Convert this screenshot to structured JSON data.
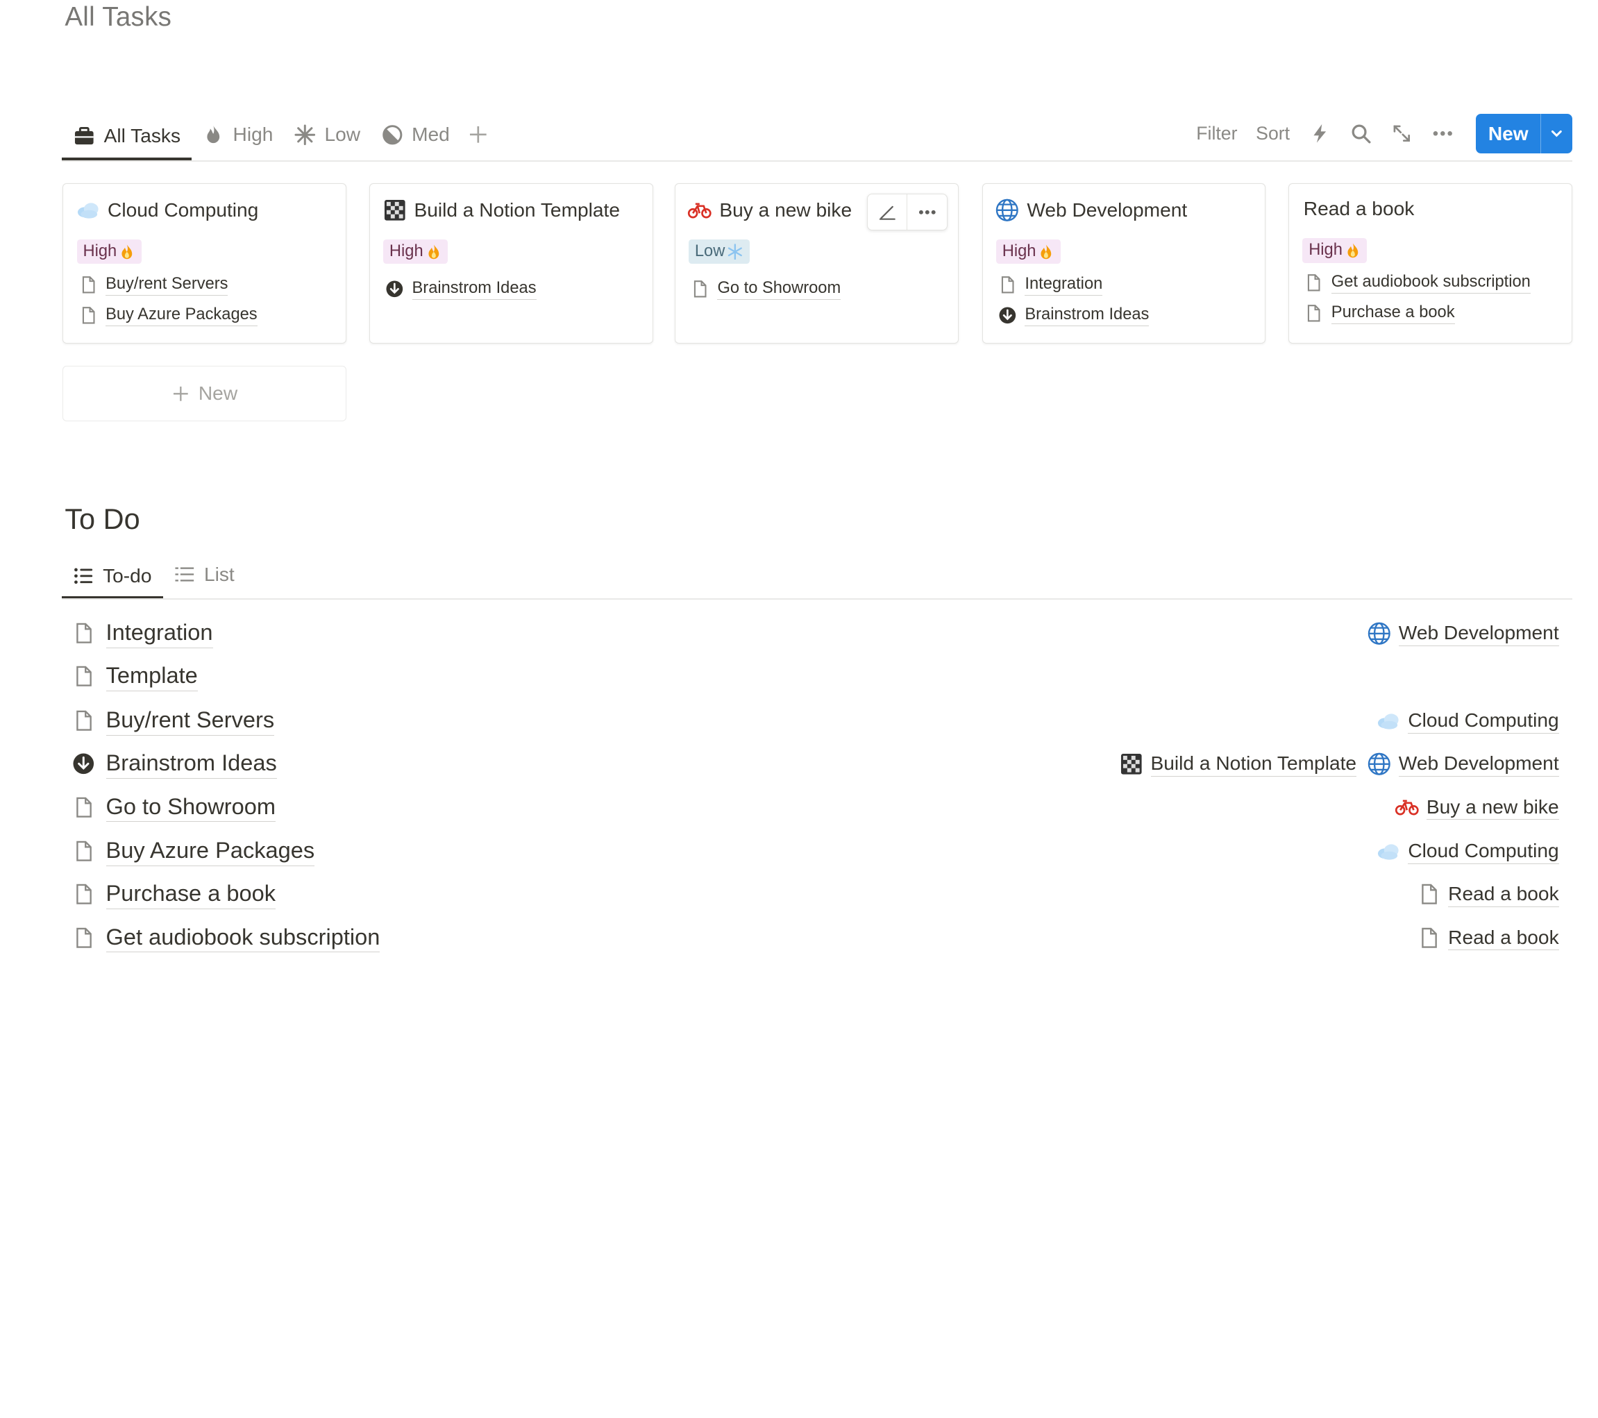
{
  "page": {
    "title": "All Tasks"
  },
  "tabs": [
    {
      "label": "All Tasks",
      "icon": "briefcase-icon",
      "active": true
    },
    {
      "label": "High",
      "icon": "flame-icon"
    },
    {
      "label": "Low",
      "icon": "snowflake-icon"
    },
    {
      "label": "Med",
      "icon": "half-circle-icon"
    }
  ],
  "toolbar": {
    "filter": "Filter",
    "sort": "Sort",
    "new_label": "New"
  },
  "colors": {
    "accent": "#2383e2",
    "high_tag_bg": "#f6e7f6",
    "low_tag_bg": "#ddebf1"
  },
  "cards": [
    {
      "title": "Cloud Computing",
      "icon": "cloud-icon",
      "priority": "High",
      "items": [
        {
          "label": "Buy/rent Servers",
          "icon": "page-icon"
        },
        {
          "label": "Buy Azure Packages",
          "icon": "page-icon"
        }
      ]
    },
    {
      "title": "Build a Notion Template",
      "icon": "checkerboard-icon",
      "priority": "High",
      "items": [
        {
          "label": "Brainstrom Ideas",
          "icon": "arrow-down-circle-icon"
        }
      ]
    },
    {
      "title": "Buy a new bike",
      "icon": "bicycle-icon",
      "priority": "Low",
      "items": [
        {
          "label": "Go to Showroom",
          "icon": "page-icon"
        }
      ]
    },
    {
      "title": "Web Development",
      "icon": "globe-icon",
      "priority": "High",
      "items": [
        {
          "label": "Integration",
          "icon": "page-icon"
        },
        {
          "label": "Brainstrom Ideas",
          "icon": "arrow-down-circle-icon"
        }
      ]
    },
    {
      "title": "Read a book",
      "icon": "",
      "priority": "High",
      "items": [
        {
          "label": "Get audiobook subscription",
          "icon": "page-icon"
        },
        {
          "label": "Purchase a book",
          "icon": "page-icon"
        }
      ]
    }
  ],
  "new_card_label": "New",
  "todo": {
    "heading": "To Do",
    "tabs": [
      {
        "label": "To-do",
        "active": true
      },
      {
        "label": "List"
      }
    ],
    "rows": [
      {
        "label": "Integration",
        "icon": "page-icon",
        "relations": [
          {
            "label": "Web Development",
            "icon": "globe-icon"
          }
        ]
      },
      {
        "label": "Template",
        "icon": "page-icon",
        "relations": []
      },
      {
        "label": "Buy/rent Servers",
        "icon": "page-icon",
        "relations": [
          {
            "label": "Cloud Computing",
            "icon": "cloud-icon"
          }
        ]
      },
      {
        "label": "Brainstrom Ideas",
        "icon": "arrow-down-circle-icon",
        "relations": [
          {
            "label": "Build a Notion Template",
            "icon": "checkerboard-icon"
          },
          {
            "label": "Web Development",
            "icon": "globe-icon"
          }
        ]
      },
      {
        "label": "Go to Showroom",
        "icon": "page-icon",
        "relations": [
          {
            "label": "Buy a new bike",
            "icon": "bicycle-icon"
          }
        ]
      },
      {
        "label": "Buy Azure Packages",
        "icon": "page-icon",
        "relations": [
          {
            "label": "Cloud Computing",
            "icon": "cloud-icon"
          }
        ]
      },
      {
        "label": "Purchase a book",
        "icon": "page-icon",
        "relations": [
          {
            "label": "Read a book",
            "icon": "page-icon"
          }
        ]
      },
      {
        "label": "Get audiobook subscription",
        "icon": "page-icon",
        "relations": [
          {
            "label": "Read a book",
            "icon": "page-icon"
          }
        ]
      }
    ]
  }
}
